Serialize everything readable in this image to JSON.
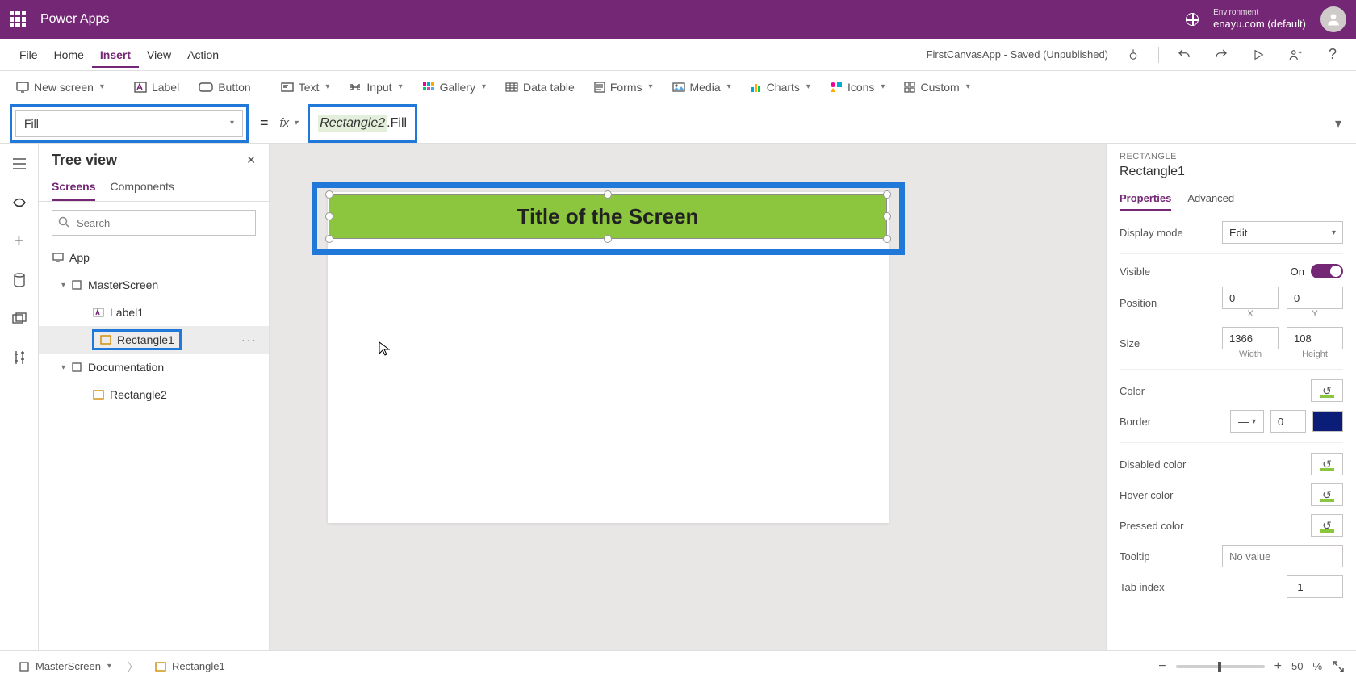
{
  "header": {
    "app_name": "Power Apps",
    "environment_label": "Environment",
    "environment_name": "enayu.com (default)"
  },
  "menubar": {
    "items": [
      "File",
      "Home",
      "Insert",
      "View",
      "Action"
    ],
    "active_index": 2,
    "save_status": "FirstCanvasApp - Saved (Unpublished)"
  },
  "ribbon": {
    "items": [
      {
        "label": "New screen",
        "has_chevron": true
      },
      {
        "label": "Label"
      },
      {
        "label": "Button"
      },
      {
        "label": "Text",
        "has_chevron": true
      },
      {
        "label": "Input",
        "has_chevron": true
      },
      {
        "label": "Gallery",
        "has_chevron": true
      },
      {
        "label": "Data table"
      },
      {
        "label": "Forms",
        "has_chevron": true
      },
      {
        "label": "Media",
        "has_chevron": true
      },
      {
        "label": "Charts",
        "has_chevron": true
      },
      {
        "label": "Icons",
        "has_chevron": true
      },
      {
        "label": "Custom",
        "has_chevron": true
      }
    ]
  },
  "formula": {
    "property": "Fill",
    "equals": "=",
    "fx": "fx",
    "reference": "Rectangle2",
    "suffix": ".Fill"
  },
  "tree": {
    "title": "Tree view",
    "tabs": [
      "Screens",
      "Components"
    ],
    "active_tab": 0,
    "search_placeholder": "Search",
    "app_label": "App",
    "nodes": {
      "master": "MasterScreen",
      "label1": "Label1",
      "rect1": "Rectangle1",
      "doc": "Documentation",
      "rect2": "Rectangle2"
    }
  },
  "canvas": {
    "title_text": "Title of the Screen"
  },
  "statusbar": {
    "breadcrumb_screen": "MasterScreen",
    "breadcrumb_item": "Rectangle1",
    "zoom_value": "50",
    "zoom_pct": "%"
  },
  "props": {
    "category": "RECTANGLE",
    "name": "Rectangle1",
    "tabs": [
      "Properties",
      "Advanced"
    ],
    "active_tab": 0,
    "display_mode_label": "Display mode",
    "display_mode_value": "Edit",
    "visible_label": "Visible",
    "visible_value": "On",
    "position_label": "Position",
    "position_x": "0",
    "position_y": "0",
    "x_label": "X",
    "y_label": "Y",
    "size_label": "Size",
    "size_w": "1366",
    "size_h": "108",
    "w_label": "Width",
    "h_label": "Height",
    "color_label": "Color",
    "border_label": "Border",
    "border_width": "0",
    "disabled_label": "Disabled color",
    "hover_label": "Hover color",
    "pressed_label": "Pressed color",
    "tooltip_label": "Tooltip",
    "tooltip_placeholder": "No value",
    "tabindex_label": "Tab index",
    "tabindex_value": "-1"
  }
}
